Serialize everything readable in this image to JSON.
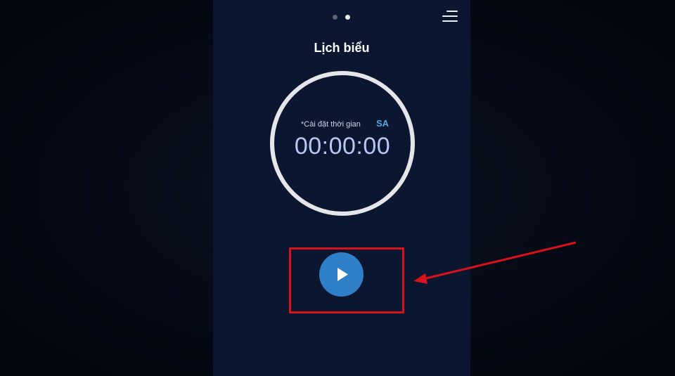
{
  "app": {
    "title": "Lịch biểu",
    "page_indicator": {
      "total": 2,
      "active": 2
    }
  },
  "header": {
    "menu_icon": "menu-icon"
  },
  "timer": {
    "hint": "*Cài đặt thời gian",
    "ampm": "SA",
    "time": "00:00:00"
  },
  "controls": {
    "play_icon": "play-icon"
  },
  "annotation": {
    "color": "#d8121b"
  },
  "colors": {
    "background": "#0b1631",
    "accent": "#2e7fc8",
    "ampm": "#55a8e0"
  }
}
